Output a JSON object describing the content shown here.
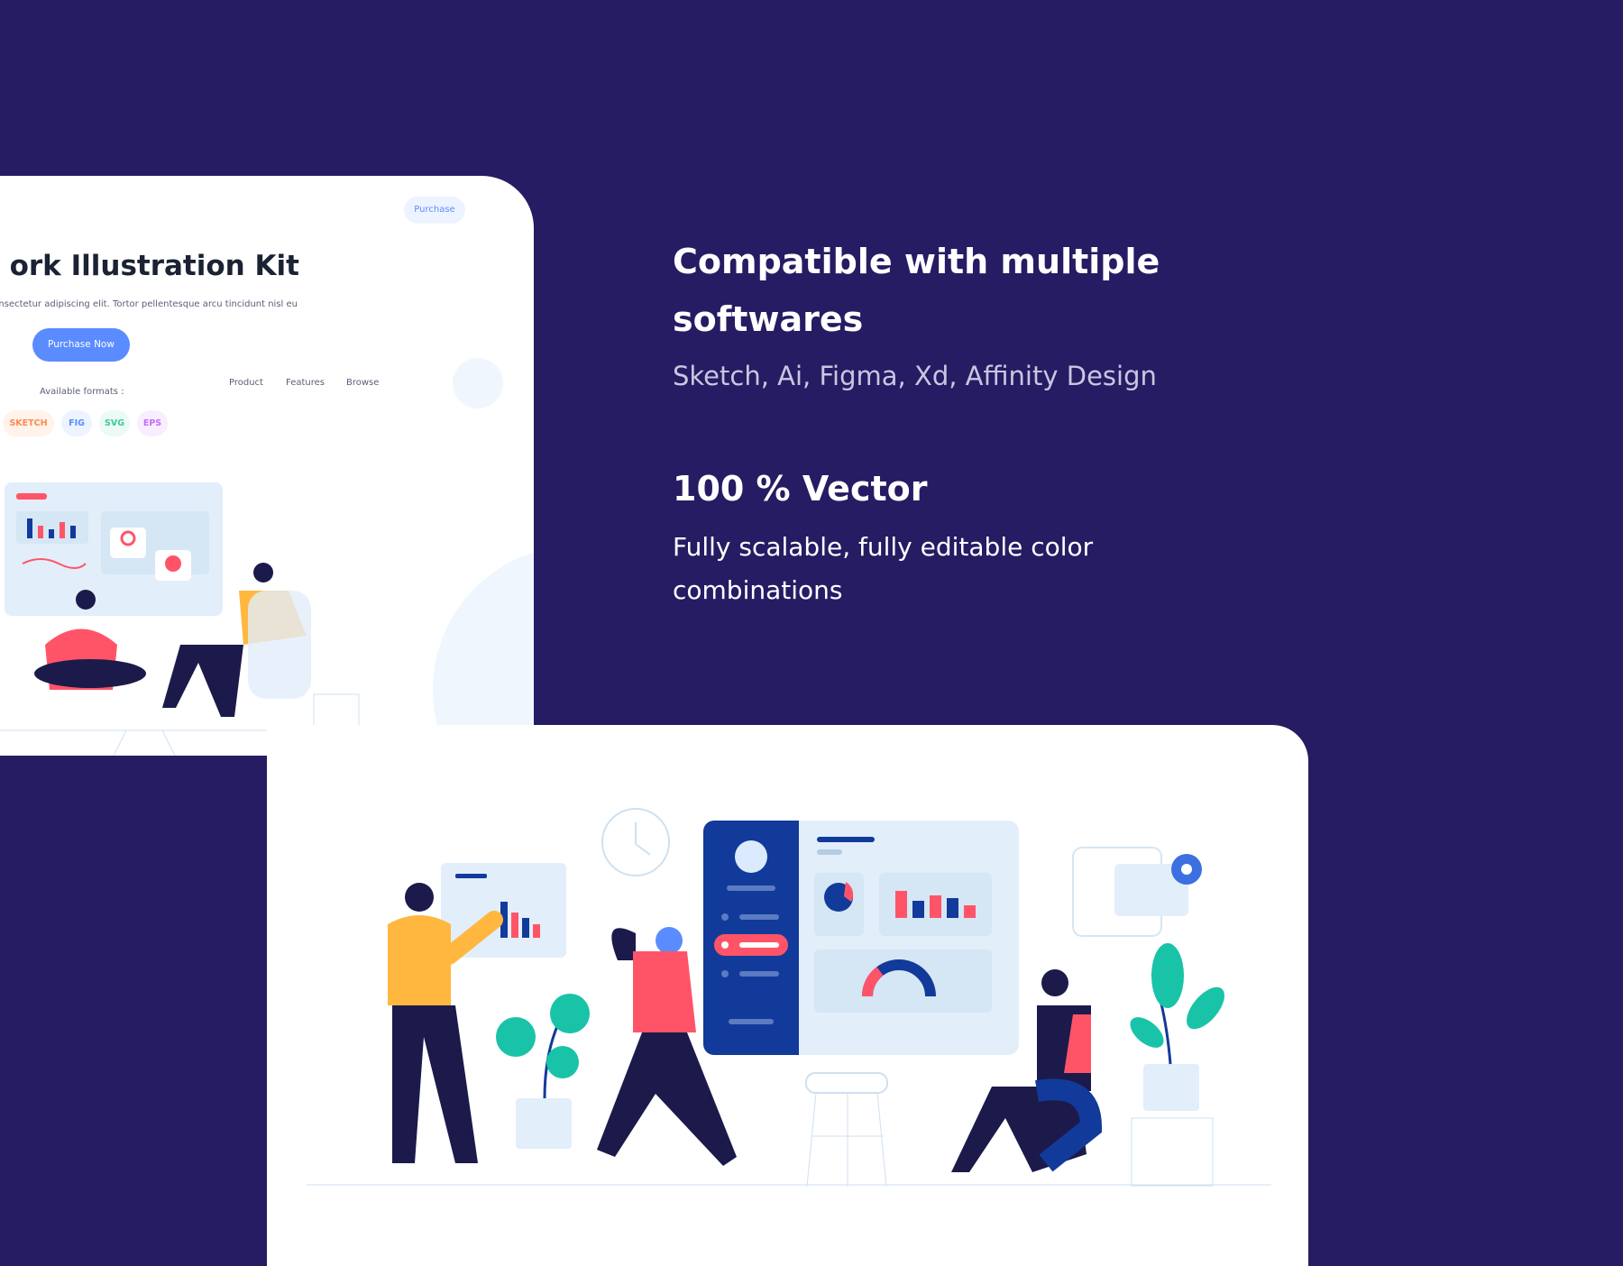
{
  "preview": {
    "nav": [
      "Product",
      "Features",
      "Browse"
    ],
    "nav_cta": "Purchase",
    "title": "ork Illustration Kit",
    "subtitle": "onsectetur adipiscing elit. Tortor pellentesque arcu tincidunt nisl eu",
    "cta": "Purchase Now",
    "formats_label": "Available formats :",
    "formats": [
      {
        "label": "SKETCH",
        "color": "#ff8a4c"
      },
      {
        "label": "FIG",
        "color": "#5b8cff"
      },
      {
        "label": "SVG",
        "color": "#3cc99a"
      },
      {
        "label": "EPS",
        "color": "#c46bff"
      }
    ]
  },
  "features": [
    {
      "title_line1": "Compatible with multiple",
      "title_line2": "softwares",
      "desc": "Sketch, Ai, Figma, Xd, Affinity Design"
    },
    {
      "title": "100 % Vector",
      "desc_line1": "Fully scalable, fully editable color",
      "desc_line2": "combinations"
    }
  ],
  "colors": {
    "background": "#261c63",
    "accent": "#5b8cff",
    "navy": "#123a9a",
    "coral": "#ff5468",
    "teal": "#19c3a8",
    "yellow": "#ffb740"
  }
}
